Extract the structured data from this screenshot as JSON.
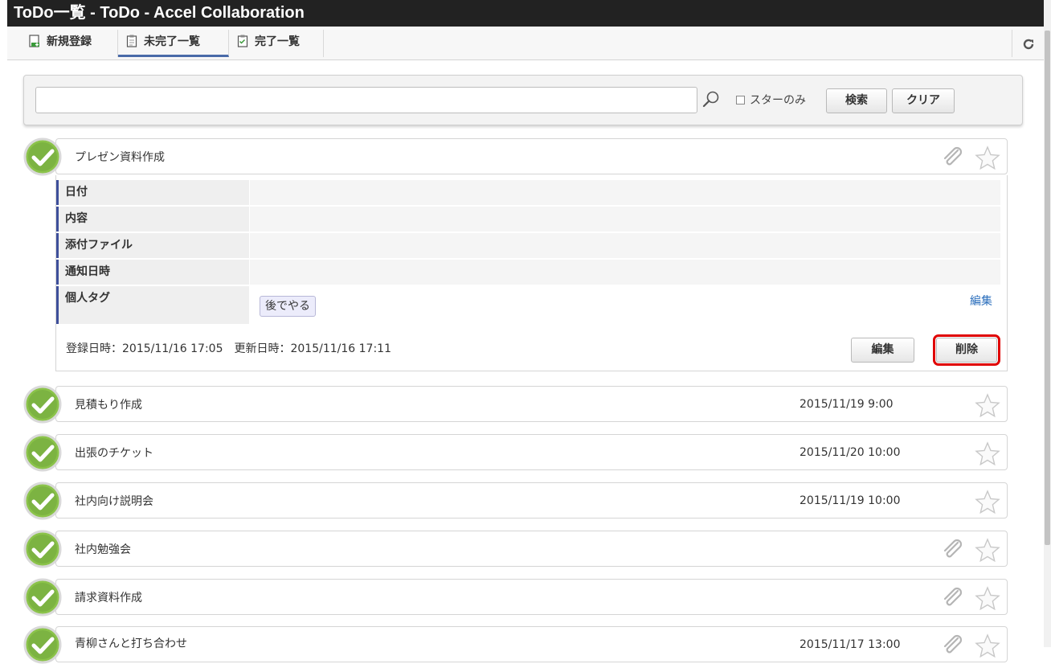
{
  "window": {
    "title": "ToDo一覧 - ToDo - Accel Collaboration"
  },
  "tabs": [
    {
      "label": "新規登録",
      "icon": "new-document-icon",
      "active": false
    },
    {
      "label": "未完了一覧",
      "icon": "clipboard-icon",
      "active": true
    },
    {
      "label": "完了一覧",
      "icon": "checklist-icon",
      "active": false
    }
  ],
  "toolbar": {
    "reload_icon": "reload-icon"
  },
  "search": {
    "value": "",
    "placeholder": "",
    "star_only_label": "スターのみ",
    "star_only_checked": false,
    "search_button": "検索",
    "clear_button": "クリア"
  },
  "expanded": {
    "title": "プレゼン資料作成",
    "fields": [
      {
        "label": "日付",
        "value": ""
      },
      {
        "label": "内容",
        "value": ""
      },
      {
        "label": "添付ファイル",
        "value": ""
      },
      {
        "label": "通知日時",
        "value": ""
      },
      {
        "label": "個人タグ",
        "value": ""
      }
    ],
    "tag": "後でやる",
    "tag_edit_link": "編集",
    "meta": "登録日時：2015/11/16 17:05　更新日時：2015/11/16 17:11",
    "edit_button": "編集",
    "delete_button": "削除"
  },
  "todos": [
    {
      "title": "見積もり作成",
      "date": "2015/11/19 9:00",
      "attachment": false
    },
    {
      "title": "出張のチケット",
      "date": "2015/11/20 10:00",
      "attachment": false
    },
    {
      "title": "社内向け説明会",
      "date": "2015/11/19 10:00",
      "attachment": false
    },
    {
      "title": "社内勉強会",
      "date": "",
      "attachment": true
    },
    {
      "title": "請求資料作成",
      "date": "",
      "attachment": true
    },
    {
      "title": "青柳さんと打ち合わせ",
      "date": "2015/11/17 13:00",
      "attachment": true
    }
  ],
  "colors": {
    "title_bar": "#222222",
    "active_tab_underline": "#4a6ba8",
    "delete_highlight": "#e00000",
    "link": "#2a6ebc",
    "check_green": "#7cb342"
  }
}
